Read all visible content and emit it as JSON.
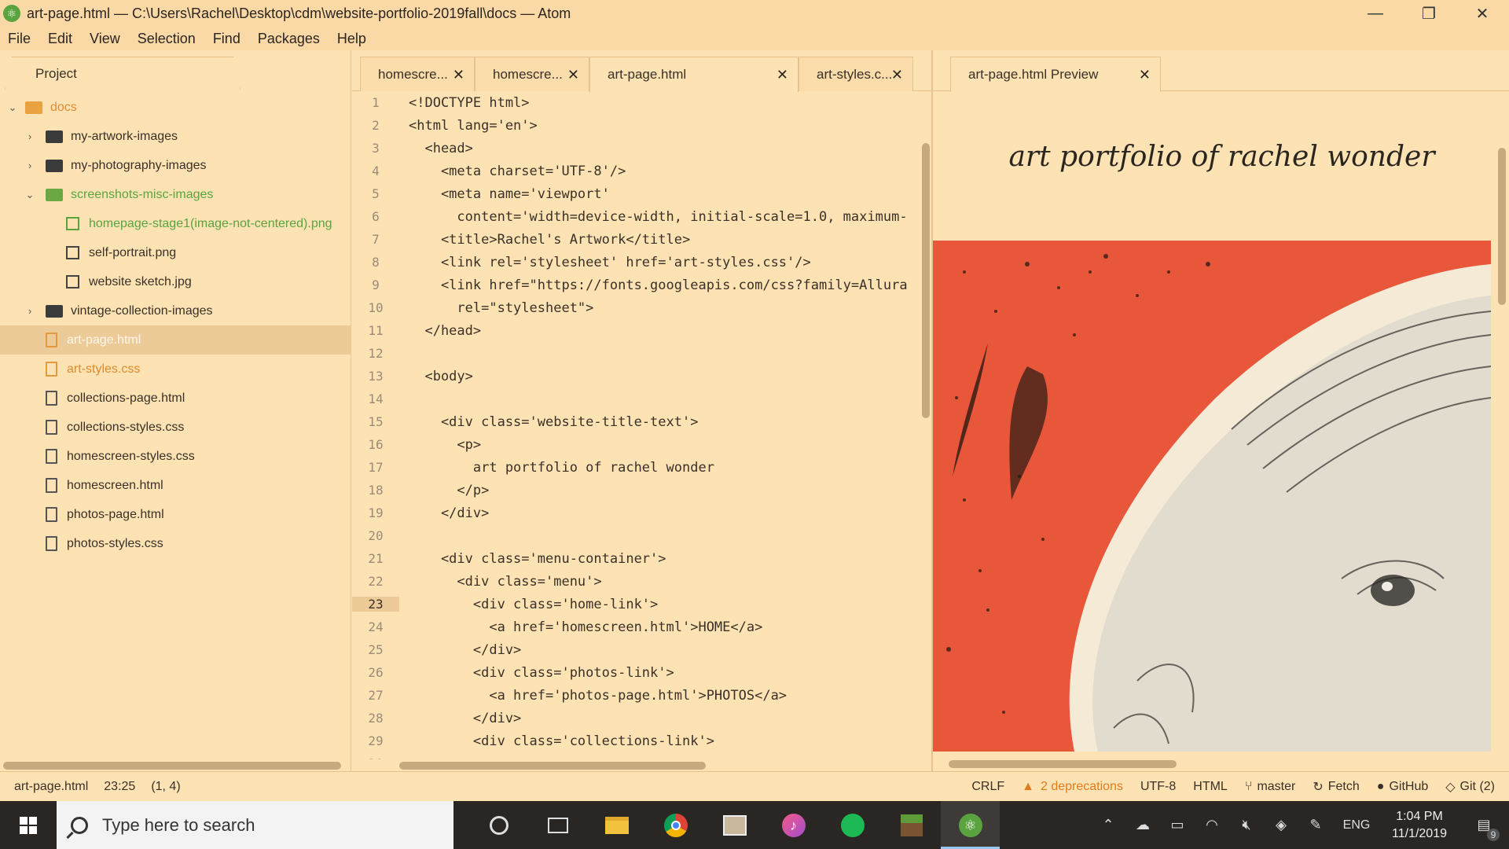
{
  "window": {
    "title": "art-page.html — C:\\Users\\Rachel\\Desktop\\cdm\\website-portfolio-2019fall\\docs — Atom",
    "minimize": "—",
    "restore": "❐",
    "close": "✕"
  },
  "menu": [
    "File",
    "Edit",
    "View",
    "Selection",
    "Find",
    "Packages",
    "Help"
  ],
  "tree": {
    "tab_label": "Project",
    "items": [
      {
        "label": "docs",
        "type": "folder-root"
      },
      {
        "label": "my-artwork-images",
        "type": "folder"
      },
      {
        "label": "my-photography-images",
        "type": "folder"
      },
      {
        "label": "screenshots-misc-images",
        "type": "folder-open"
      },
      {
        "label": "homepage-stage1(image-not-centered).png",
        "type": "image-new"
      },
      {
        "label": "self-portrait.png",
        "type": "image"
      },
      {
        "label": "website sketch.jpg",
        "type": "image"
      },
      {
        "label": "vintage-collection-images",
        "type": "folder"
      },
      {
        "label": "art-page.html",
        "type": "file-selected"
      },
      {
        "label": "art-styles.css",
        "type": "file-modified"
      },
      {
        "label": "collections-page.html",
        "type": "file"
      },
      {
        "label": "collections-styles.css",
        "type": "file"
      },
      {
        "label": "homescreen-styles.css",
        "type": "file"
      },
      {
        "label": "homescreen.html",
        "type": "file"
      },
      {
        "label": "photos-page.html",
        "type": "file"
      },
      {
        "label": "photos-styles.css",
        "type": "file"
      }
    ]
  },
  "editor": {
    "tabs": [
      {
        "label": "homescre...",
        "close": "✕"
      },
      {
        "label": "homescre...",
        "close": "✕"
      },
      {
        "label": "art-page.html",
        "close": "✕"
      },
      {
        "label": "art-styles.c...",
        "close": "✕"
      }
    ],
    "current_line": 23,
    "lines": [
      "<!DOCTYPE html>",
      "<html lang='en'>",
      "  <head>",
      "    <meta charset='UTF-8'/>",
      "    <meta name='viewport'",
      "      content='width=device-width, initial-scale=1.0, maximum-",
      "    <title>Rachel's Artwork</title>",
      "    <link rel='stylesheet' href='art-styles.css'/>",
      "    <link href=\"https://fonts.googleapis.com/css?family=Allura",
      "      rel=\"stylesheet\">",
      "  </head>",
      "",
      "  <body>",
      "",
      "    <div class='website-title-text'>",
      "      <p>",
      "        art portfolio of rachel wonder",
      "      </p>",
      "    </div>",
      "",
      "    <div class='menu-container'>",
      "      <div class='menu'>",
      "        <div class='home-link'>",
      "          <a href='homescreen.html'>HOME</a>",
      "        </div>",
      "        <div class='photos-link'>",
      "          <a href='photos-page.html'>PHOTOS</a>",
      "        </div>",
      "        <div class='collections-link'>",
      ""
    ]
  },
  "preview": {
    "tab_label": "art-page.html Preview",
    "tab_close": "✕",
    "heading": "art portfolio of rachel wonder"
  },
  "status": {
    "file": "art-page.html",
    "cursor": "23:25",
    "selection": "(1, 4)",
    "line_ending": "CRLF",
    "deprecations": "2 deprecations",
    "encoding": "UTF-8",
    "grammar": "HTML",
    "branch": "master",
    "fetch": "Fetch",
    "github": "GitHub",
    "git": "Git (2)"
  },
  "taskbar": {
    "search_placeholder": "Type here to search",
    "time": "1:04 PM",
    "date": "11/1/2019",
    "language": "ENG",
    "notifications": "9"
  },
  "colors": {
    "background": "#fde3b4",
    "accent_green": "#5aa33f",
    "modified_orange": "#e18b2d",
    "art_red": "#e8573a"
  }
}
